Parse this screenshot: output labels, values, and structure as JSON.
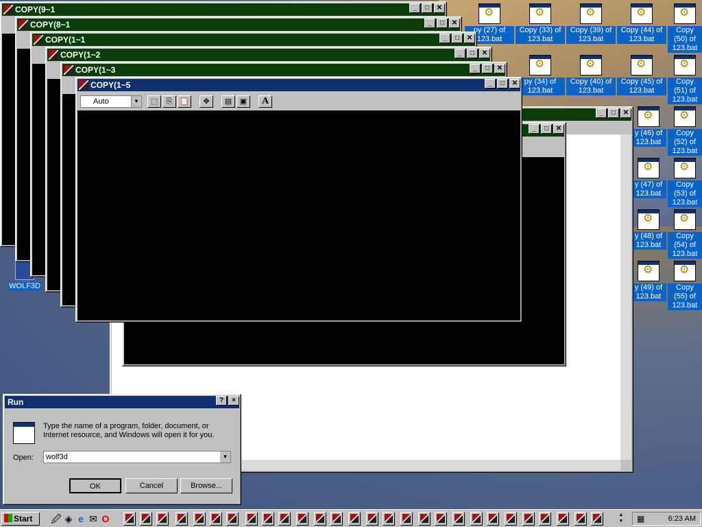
{
  "desktop": {
    "wolf3d_label": "WOLF3D",
    "icons": [
      "py (27) of 123.bat",
      "Copy (33) of 123.bat",
      "Copy (39) of 123.bat",
      "Copy (44) of 123.bat",
      "Copy (50) of 123.bat",
      "py (34) of 123.bat",
      "Copy (40) of 123.bat",
      "Copy (45) of 123.bat",
      "Copy (51) of 123.bat",
      "y (46) of 123.bat",
      "Copy (52) of 123.bat",
      "y (47) of 123.bat",
      "Copy (53) of 123.bat",
      "y (48) of 123.bat",
      "Copy (54) of 123.bat",
      "y (49) of 123.bat",
      "Copy (55) of 123.bat"
    ]
  },
  "windows": {
    "w1": "COPY(9~1",
    "w2": "COPY(8~1",
    "w3": "COPY(1~1",
    "w4": "COPY(1~2",
    "w5": "COPY(1~3",
    "w6": "COPY(1~5"
  },
  "msdos": {
    "font_value": "Auto"
  },
  "run_dialog": {
    "title": "Run",
    "help_label": "?",
    "close_label": "×",
    "description": "Type the name of a program, folder, document, or Internet resource, and Windows will open it for you.",
    "open_label": "Open:",
    "open_value": "wolf3d",
    "ok_label": "OK",
    "cancel_label": "Cancel",
    "browse_label": "Browse..."
  },
  "taskbar": {
    "start_label": "Start",
    "clock": "6:23 AM"
  }
}
